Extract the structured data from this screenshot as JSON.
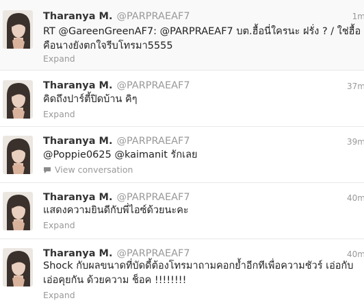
{
  "tweets": [
    {
      "fullname": "Tharanya M.",
      "username": "@PARPRAEAF7",
      "time": "1m",
      "text": "RT @GareenGreenAF7: @PARPRAEAF7 บต.ฮื้อนี่ใครนะ ฝรั่ง ? / ใช่ฮื้อ\nคือนางยังตกใจรีบโทรมา5555",
      "action": "Expand"
    },
    {
      "fullname": "Tharanya M.",
      "username": "@PARPRAEAF7",
      "time": "37m",
      "text": "คิดถึงปาร์ตี้ปิดบ้าน คิๆ",
      "action": "Expand"
    },
    {
      "fullname": "Tharanya M.",
      "username": "@PARPRAEAF7",
      "time": "39m",
      "text": "@Poppie0625 @kaimanit รักเลย",
      "action": "View conversation"
    },
    {
      "fullname": "Tharanya M.",
      "username": "@PARPRAEAF7",
      "time": "40m",
      "text": "แสดงความยินดีกับพี่ไอซ์ด้วยนะคะ",
      "action": "Expand"
    },
    {
      "fullname": "Tharanya M.",
      "username": "@PARPRAEAF7",
      "time": "40m",
      "text": "Shock กับผลขนาดที่บัดดี้ต้องโทรมาถามคอกย้ำอีกทีเพื่อความชัวร์ เอ่อกับ\nเอ่อคุยกัน ด้วยความ ช็อค !!!!!!!!",
      "action": "Expand"
    }
  ]
}
